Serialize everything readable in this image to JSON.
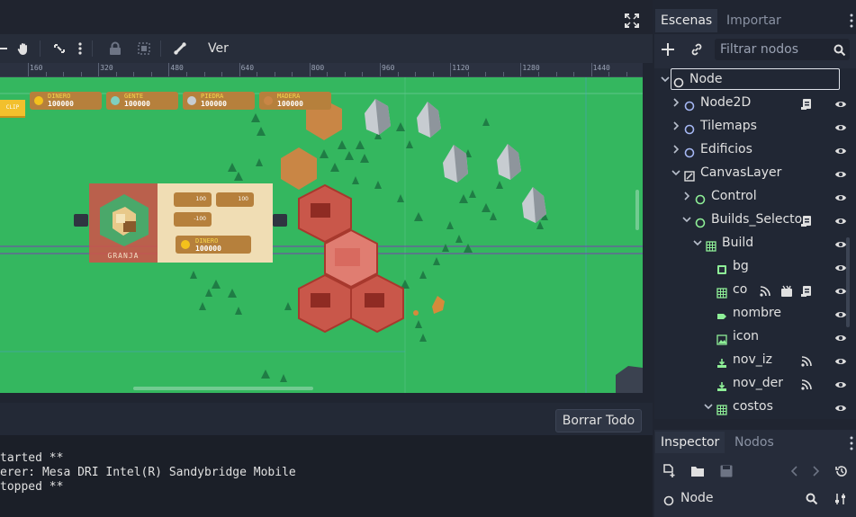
{
  "scene_tabs": {
    "active": "Escenas",
    "inactive": "Importar"
  },
  "scene_filter": {
    "placeholder": "Filtrar nodos"
  },
  "toolbar": {
    "view_label": "Ver"
  },
  "ruler": {
    "labels": [
      "160",
      "320",
      "480",
      "640",
      "800",
      "960",
      "1120",
      "1280",
      "1440"
    ]
  },
  "tree": [
    {
      "label": "Node",
      "type": "node",
      "expanded": true,
      "selected": true
    },
    {
      "label": "Node2D",
      "type": "node2d",
      "expanded": false,
      "script": true
    },
    {
      "label": "Tilemaps",
      "type": "node2d",
      "expanded": false
    },
    {
      "label": "Edificios",
      "type": "node2d",
      "expanded": false
    },
    {
      "label": "CanvasLayer",
      "type": "canvaslayer",
      "expanded": true
    },
    {
      "label": "Control",
      "type": "control",
      "expanded": false
    },
    {
      "label": "Builds_Selecto",
      "type": "control",
      "expanded": true,
      "script": true
    },
    {
      "label": "Build",
      "type": "gridcontainer",
      "expanded": true
    },
    {
      "label": "bg",
      "type": "panel"
    },
    {
      "label": "co",
      "type": "gridcontainer",
      "signals": true,
      "groups": true,
      "script": true
    },
    {
      "label": "nombre",
      "type": "label"
    },
    {
      "label": "icon",
      "type": "texturerect"
    },
    {
      "label": "nov_iz",
      "type": "button",
      "signals": true
    },
    {
      "label": "nov_der",
      "type": "button",
      "signals": true
    },
    {
      "label": "costos",
      "type": "gridcontainer",
      "expanded": true
    }
  ],
  "inspector_tabs": {
    "active": "Inspector",
    "inactive": "Nodos"
  },
  "inspector": {
    "node_label": "Node"
  },
  "output": {
    "clear_label": "Borrar Todo",
    "lines": [
      "tarted **",
      "erer: Mesa DRI Intel(R) Sandybridge Mobile",
      "topped **"
    ]
  },
  "game": {
    "resources": [
      {
        "name": "DINERO",
        "value": "100000"
      },
      {
        "name": "GENTE",
        "value": "100000"
      },
      {
        "name": "PIEDRA",
        "value": "100000"
      },
      {
        "name": "MADERA",
        "value": "100000"
      }
    ],
    "build_card": {
      "name": "GRANJA",
      "cost_a": "100",
      "cost_b": "100",
      "cost_c": "-100",
      "price_label": "DINERO",
      "price_value": "100000"
    },
    "left_button": "CLIP"
  },
  "colors": {
    "accent": "#8eef97",
    "grass": "#34b75f",
    "hex_red": "#c9574a",
    "hex_brown": "#c98645"
  }
}
